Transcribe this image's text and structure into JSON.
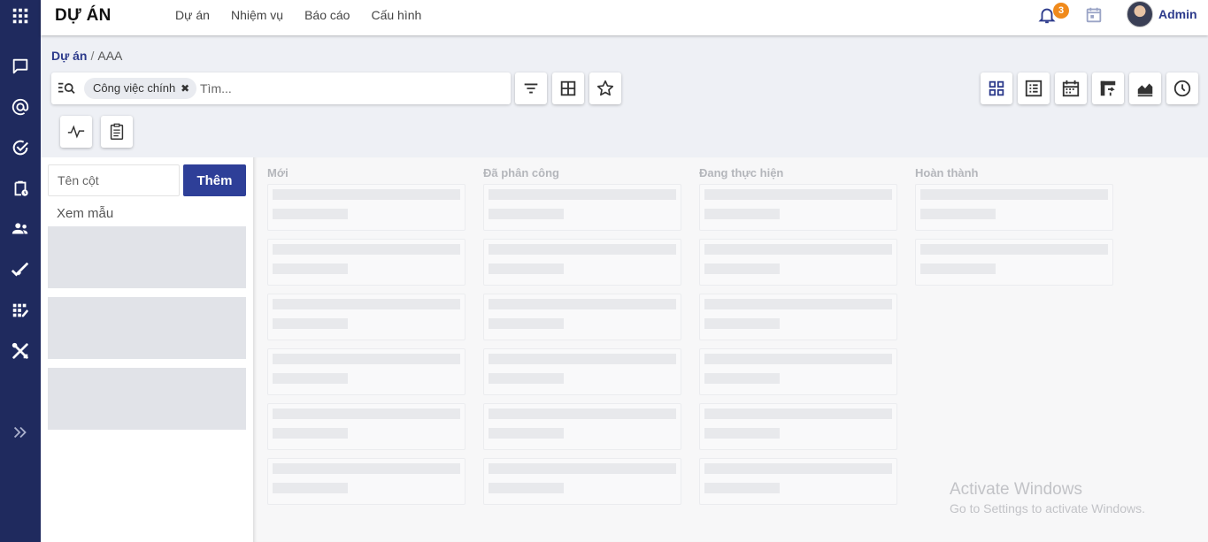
{
  "rail": {
    "items": [
      {
        "icon": "apps-grid-icon"
      },
      {
        "icon": "chat-icon"
      },
      {
        "icon": "at-sign-icon"
      },
      {
        "icon": "check-circle-icon"
      },
      {
        "icon": "clipboard-clock-icon"
      },
      {
        "icon": "users-icon"
      },
      {
        "icon": "double-check-icon"
      },
      {
        "icon": "task-grid-icon"
      },
      {
        "icon": "tools-icon"
      },
      {
        "icon": "expand-chevrons-icon"
      }
    ],
    "color": "#1f2a5e"
  },
  "header": {
    "app_title": "DỰ ÁN",
    "menu": [
      "Dự án",
      "Nhiệm vụ",
      "Báo cáo",
      "Cấu hình"
    ],
    "notification_count": "3",
    "user_name": "Admin",
    "accent": "#2d3b8c",
    "badge_color": "#f08a1c"
  },
  "breadcrumb": {
    "root": "Dự án",
    "separator": "/",
    "current": "AAA"
  },
  "search": {
    "facet": "Công việc chính",
    "facet_remove": "✖",
    "placeholder": "Tìm..."
  },
  "toolbar": {
    "left_buttons": [
      "filter-icon",
      "group-by-icon",
      "favorite-star-icon"
    ],
    "view_buttons": [
      "kanban-view-icon",
      "list-view-icon",
      "calendar-view-icon",
      "pivot-view-icon",
      "graph-view-icon",
      "activity-view-icon"
    ],
    "extra_buttons": [
      "pulse-icon",
      "clipboard-icon"
    ]
  },
  "kanban_setup": {
    "column_placeholder": "Tên cột",
    "add_label": "Thêm",
    "preview_label": "Xem mẫu",
    "button_color": "#2e3f98"
  },
  "board": {
    "columns": [
      {
        "title": "Mới",
        "cards": 6
      },
      {
        "title": "Đã phân công",
        "cards": 6
      },
      {
        "title": "Đang thực hiện",
        "cards": 6
      },
      {
        "title": "Hoàn thành",
        "cards": 2
      }
    ]
  },
  "watermark": {
    "title": "Activate Windows",
    "subtitle": "Go to Settings to activate Windows."
  }
}
